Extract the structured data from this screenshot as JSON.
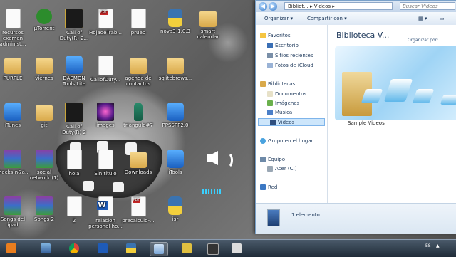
{
  "desktop_icons": [
    {
      "id": "recursos-examen",
      "label": "recursos examen administ...",
      "type": "doc"
    },
    {
      "id": "utorrent",
      "label": "µTorrent",
      "type": "utor"
    },
    {
      "id": "cod-32",
      "label": "Call of Duty(R) 2...",
      "type": "cod"
    },
    {
      "id": "hoja-trabajo",
      "label": "HojadeTrab...",
      "type": "pdf"
    },
    {
      "id": "prueb",
      "label": "prueb",
      "type": "doc"
    },
    {
      "id": "nova",
      "label": "nova3-1.0.3",
      "type": "python"
    },
    {
      "id": "smart-calendar",
      "label": "smart calendar",
      "type": "folder"
    },
    {
      "id": "purple",
      "label": "PURPLE",
      "type": "folder"
    },
    {
      "id": "viernes",
      "label": "viernes",
      "type": "folder"
    },
    {
      "id": "daemon",
      "label": "DAEMON Tools Lite",
      "type": "blue"
    },
    {
      "id": "callofduty",
      "label": "CallofDuty...",
      "type": "doc"
    },
    {
      "id": "agenda",
      "label": "agenda de contactos",
      "type": "folder"
    },
    {
      "id": "sqlitebrows",
      "label": "sqlitebrows...",
      "type": "folder"
    },
    {
      "id": "itunes",
      "label": "iTunes",
      "type": "blue"
    },
    {
      "id": "git",
      "label": "git",
      "type": "folder"
    },
    {
      "id": "cod-2",
      "label": "Call of Duty(R) 2",
      "type": "cod"
    },
    {
      "id": "images",
      "label": "images",
      "type": "flower"
    },
    {
      "id": "triangulo",
      "label": "triangulo#7",
      "type": "bottle"
    },
    {
      "id": "ppsspp",
      "label": "PPSSPP2.0",
      "type": "blue"
    },
    {
      "id": "shacks",
      "label": "shacks-n&a...",
      "type": "winrar"
    },
    {
      "id": "social-network",
      "label": "social network (1)",
      "type": "winrar"
    },
    {
      "id": "hola",
      "label": "hola",
      "type": "doc"
    },
    {
      "id": "sin-titulo",
      "label": "Sin título",
      "type": "doc"
    },
    {
      "id": "downloads",
      "label": "Downloads",
      "type": "folder"
    },
    {
      "id": "itools",
      "label": "iTools",
      "type": "blue"
    },
    {
      "id": "songs-ipad",
      "label": "Songs del ipad",
      "type": "winrar"
    },
    {
      "id": "songs2",
      "label": "Songs 2",
      "type": "winrar"
    },
    {
      "id": "doc-2",
      "label": "2",
      "type": "doc"
    },
    {
      "id": "relacion",
      "label": "relacion personal ho...",
      "type": "word"
    },
    {
      "id": "precalculo",
      "label": "precalculo-...",
      "type": "pdf"
    },
    {
      "id": "isr",
      "label": "isr",
      "type": "python"
    }
  ],
  "volume_osd": {
    "icon": "speaker-icon",
    "level": 0.35
  },
  "explorer": {
    "address_parts": [
      "Bibliot...",
      "Videos"
    ],
    "search_placeholder": "Buscar Videos",
    "toolbar": {
      "organize": "Organizar",
      "share": "Compartir con"
    },
    "nav": {
      "favorites_header": "Favoritos",
      "favorites": [
        "Escritorio",
        "Sitios recientes",
        "Fotos de iCloud"
      ],
      "libraries_header": "Bibliotecas",
      "libraries": [
        "Documentos",
        "Imágenes",
        "Música",
        "Videos"
      ],
      "homegroup": "Grupo en el hogar",
      "computer": "Equipo",
      "drive": "Acer (C:)",
      "network": "Red"
    },
    "library_title": "Biblioteca V...",
    "organize_by": "Organizar por:",
    "item_label": "Sample Videos",
    "status": "1 elemento"
  },
  "taskbar": {
    "items": [
      "windows-media-player",
      "start-orb",
      "chrome",
      "word",
      "python",
      "explorer",
      "tool",
      "network",
      "notepad"
    ],
    "lang": "ES"
  },
  "colors": {
    "accent": "#3a7bc8",
    "selection": "#cde6fb"
  }
}
